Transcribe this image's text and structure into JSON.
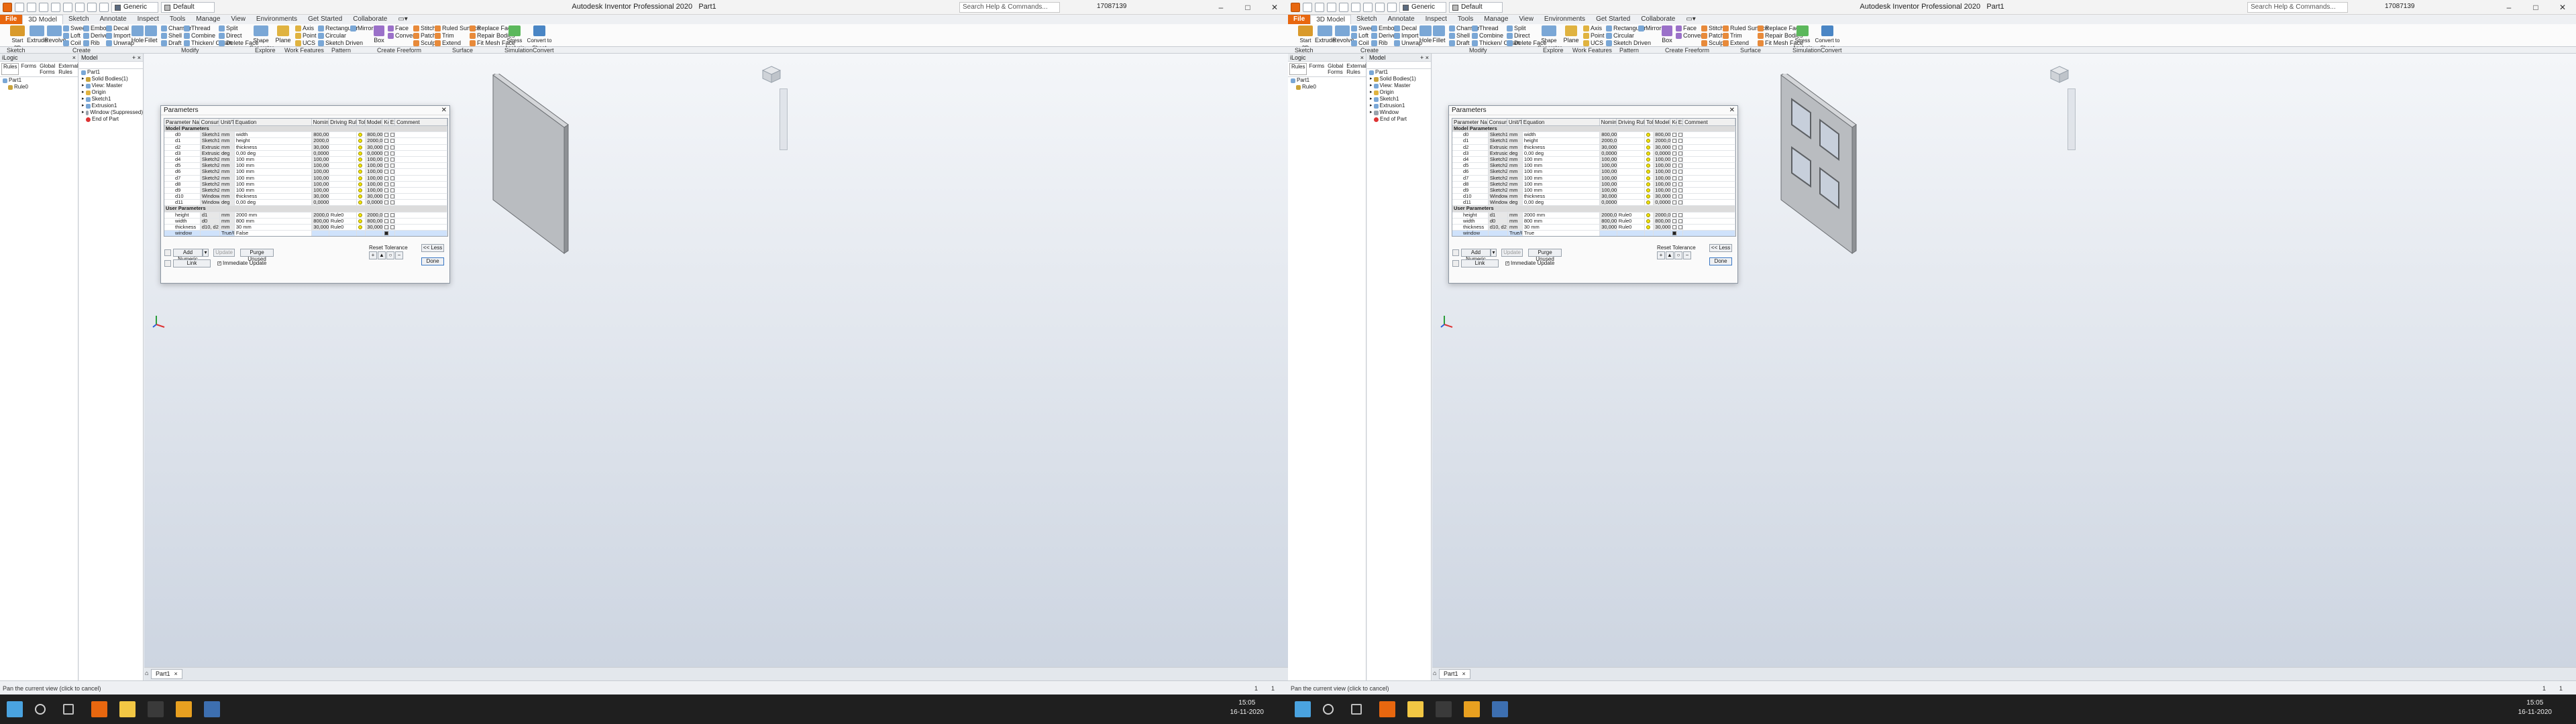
{
  "title_bar": {
    "app_title": "Autodesk Inventor Professional 2020",
    "doc_name": "Part1",
    "appearance": "Generic",
    "material": "Default",
    "search_placeholder": "Search Help & Commands...",
    "user": "17087139"
  },
  "ribbon_tabs": [
    "File",
    "3D Model",
    "Sketch",
    "Annotate",
    "Inspect",
    "Tools",
    "Manage",
    "View",
    "Environments",
    "Get Started",
    "Collaborate"
  ],
  "ribbon_tools": {
    "start_sketch": "Start\n2D Sketch",
    "extrude": "Extrude",
    "revolve": "Revolve",
    "sweep": "Sweep",
    "loft": "Loft",
    "coil": "Coil",
    "emboss": "Emboss",
    "derive": "Derive",
    "rib": "Rib",
    "decal": "Decal",
    "import": "Import",
    "unwrap": "Unwrap",
    "hole": "Hole",
    "fillet": "Fillet",
    "chamfer": "Chamfer",
    "shell": "Shell",
    "draft": "Draft",
    "thread": "Thread",
    "combine": "Combine",
    "thicken": "Thicken/ Offset",
    "split": "Split",
    "direct": "Direct",
    "delete_face": "Delete Face",
    "shape_generator": "Shape\nGenerator",
    "plane": "Plane",
    "axis": "Axis",
    "point": "Point",
    "ucs": "UCS",
    "rectangular": "Rectangular",
    "circular": "Circular",
    "sketch_driven": "Sketch Driven",
    "mirror": "Mirror",
    "box": "Box",
    "face": "Face",
    "convert": "Convert",
    "stitch": "Stitch",
    "patch": "Patch",
    "sculpt": "Sculpt",
    "ruled_surface": "Ruled Surface",
    "trim": "Trim",
    "extend": "Extend",
    "replace_face": "Replace Face",
    "repair_bodies": "Repair Bodies",
    "fit_mesh_face": "Fit Mesh Face",
    "stress_analysis": "Stress\nAnalysis",
    "convert_sheet_metal": "Convert to\nSheet Metal"
  },
  "ribbon_panels": [
    "Sketch",
    "Create",
    "Modify",
    "Explore",
    "Work Features",
    "Pattern",
    "Create Freeform",
    "Surface",
    "Simulation",
    "Convert"
  ],
  "rules_browser": {
    "title": "iLogic",
    "tabs": [
      "Rules",
      "Forms",
      "Global Forms",
      "External Rules"
    ],
    "tree": [
      "Part1",
      "Rule0"
    ]
  },
  "model_browser": {
    "title": "Model",
    "root": "Part1",
    "nodes_left": [
      "Solid Bodies(1)",
      "View: Master",
      "Origin",
      "Sketch1",
      "Extrusion1",
      "Window (Suppressed)",
      "End of Part"
    ],
    "nodes_right": [
      "Solid Bodies(1)",
      "View: Master",
      "Origin",
      "Sketch1",
      "Extrusion1",
      "Window",
      "End of Part"
    ]
  },
  "dialog": {
    "title": "Parameters",
    "headers": [
      "Parameter Name",
      "Consumed b",
      "Unit/Type",
      "Equation",
      "Nominal V",
      "Driving Rule",
      "Tol.",
      "Model Val",
      "Key",
      "Export",
      "Comment"
    ],
    "group_model": "Model Parameters",
    "group_user": "User Parameters",
    "model_rows": [
      [
        "d0",
        "Sketch1",
        "mm",
        "width",
        "800,00..."
      ],
      [
        "d1",
        "Sketch1",
        "mm",
        "height",
        "2000,0..."
      ],
      [
        "d2",
        "Extrusion1",
        "mm",
        "thickness",
        "30,000..."
      ],
      [
        "d3",
        "Extrusion1",
        "deg",
        "0,00 deg",
        "0,000000"
      ],
      [
        "d4",
        "Sketch2",
        "mm",
        "100 mm",
        "100,00..."
      ],
      [
        "d5",
        "Sketch2",
        "mm",
        "100 mm",
        "100,00..."
      ],
      [
        "d6",
        "Sketch2",
        "mm",
        "100 mm",
        "100,00..."
      ],
      [
        "d7",
        "Sketch2",
        "mm",
        "100 mm",
        "100,00..."
      ],
      [
        "d8",
        "Sketch2",
        "mm",
        "100 mm",
        "100,00..."
      ],
      [
        "d9",
        "Sketch2",
        "mm",
        "100 mm",
        "100,00..."
      ],
      [
        "d10",
        "Window",
        "mm",
        "thickness",
        "30,000..."
      ],
      [
        "d11",
        "Window",
        "deg",
        "0,00 deg",
        "0,000000"
      ]
    ],
    "user_rows": [
      [
        "height",
        "d1",
        "mm",
        "2000 mm",
        "2000,0...",
        "Rule0"
      ],
      [
        "width",
        "d0",
        "mm",
        "800 mm",
        "800,00...",
        "Rule0"
      ],
      [
        "thickness",
        "d10, d2",
        "mm",
        "30 mm",
        "30,000...",
        "Rule0"
      ]
    ],
    "window_row_left": [
      "window",
      "",
      "True/F...",
      "False"
    ],
    "window_row_right": [
      "window",
      "",
      "True/F...",
      "True"
    ],
    "buttons": {
      "add_numeric": "Add Numeric",
      "update": "Update",
      "purge": "Purge Unused",
      "link": "Link",
      "immediate": "Immediate Update",
      "reset_tol": "Reset Tolerance",
      "less": "<< Less",
      "done": "Done"
    }
  },
  "doc_tab": "Part1",
  "status_text": "Pan the current view (click to cancel)",
  "status_counts": [
    "1",
    "1"
  ],
  "clock_time": "15:05",
  "clock_date": "16-11-2020"
}
